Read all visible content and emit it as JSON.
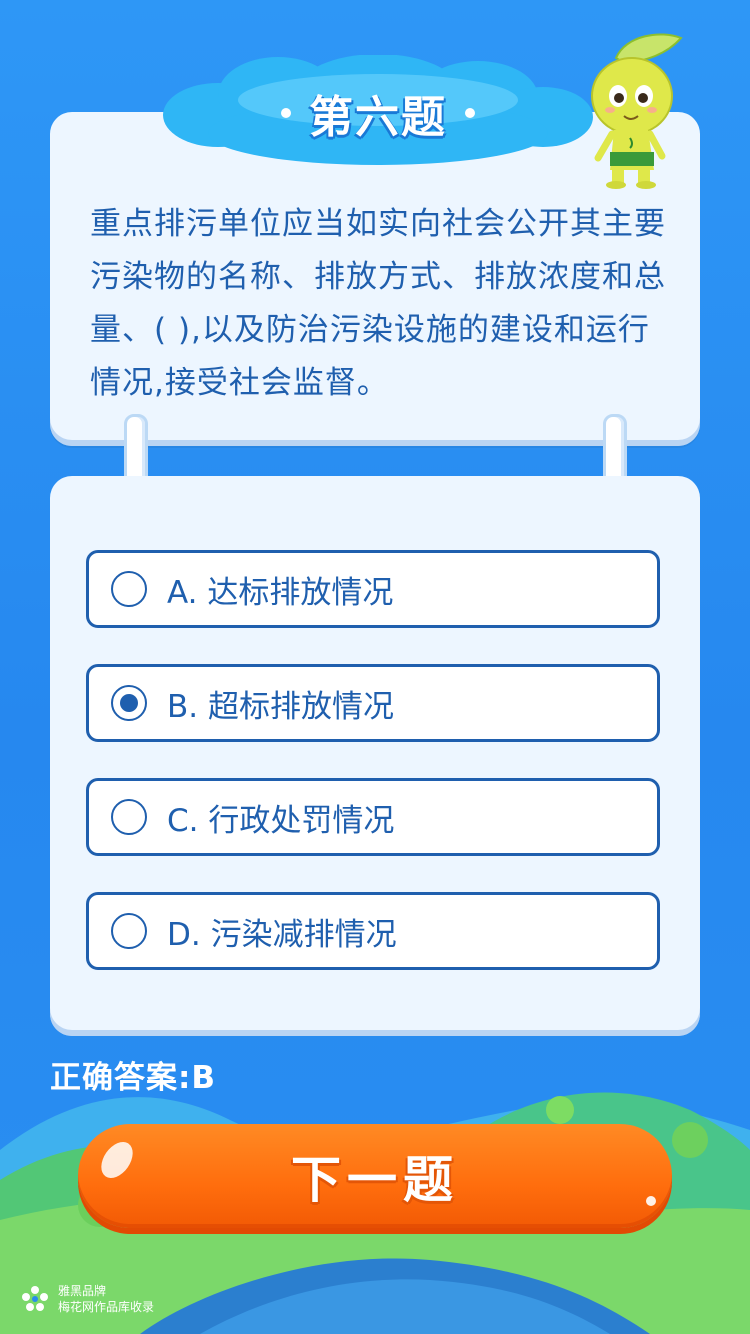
{
  "question": {
    "title": "第六题",
    "text": "重点排污单位应当如实向社会公开其主要污染物的名称、排放方式、排放浓度和总量、(  ),以及防治污染设施的建设和运行情况,接受社会监督。"
  },
  "options": [
    {
      "label": "A. 达标排放情况",
      "selected": false
    },
    {
      "label": "B. 超标排放情况",
      "selected": true
    },
    {
      "label": "C. 行政处罚情况",
      "selected": false
    },
    {
      "label": "D. 污染减排情况",
      "selected": false
    }
  ],
  "answer": {
    "label": "正确答案:",
    "value": "B"
  },
  "next_button": {
    "label": "下一题"
  },
  "brand": {
    "line1": "雅黑品牌",
    "line2": "梅花网作品库收录"
  },
  "colors": {
    "accent": "#1f5fae",
    "button": "#ff7412",
    "background": "#2a8cf0"
  }
}
